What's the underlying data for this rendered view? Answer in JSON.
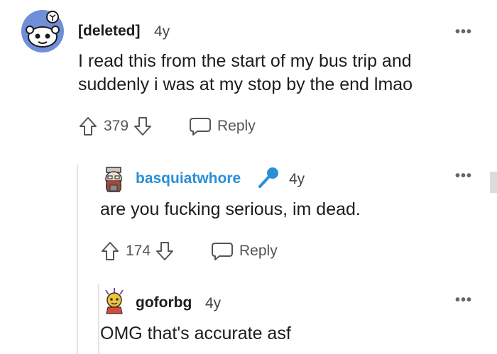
{
  "comments": [
    {
      "author": "[deleted]",
      "age": "4y",
      "text_lines": [
        "I read this from the start of my bus trip and",
        "suddenly i was at my stop by the end lmao"
      ],
      "score": "379",
      "reply_label": "Reply",
      "avatar_icon": "reddit-snoo-avatar-icon"
    },
    {
      "author": "basquiatwhore",
      "author_color": "#2a8fd6",
      "age": "4y",
      "text": "are you fucking serious, im dead.",
      "score": "174",
      "reply_label": "Reply",
      "flair_icon": "microphone-icon",
      "avatar_icon": "user-avatar-icon"
    },
    {
      "author": "goforbg",
      "age": "4y",
      "text": "OMG that's accurate asf",
      "avatar_icon": "user-avatar-icon"
    }
  ],
  "more_label": "•••"
}
